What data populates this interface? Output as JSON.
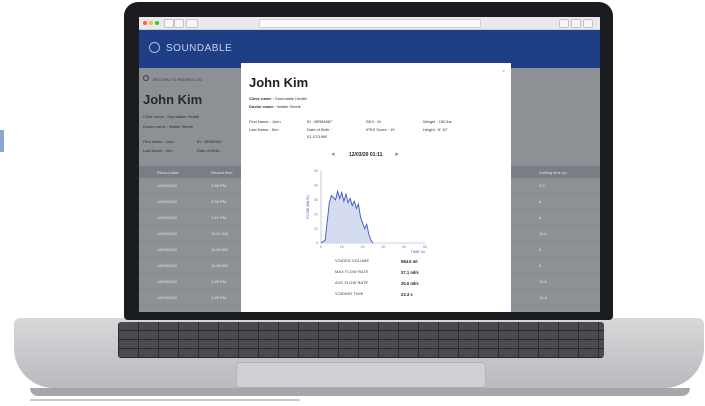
{
  "app": {
    "brand": "SOUNDABLE"
  },
  "background_page": {
    "back_link": "RETURN TO PATIENT LIST",
    "patient_name": "John Kim",
    "clinic_line": "Clinic name : Soundable Health",
    "doctor_line": "Doctor name : Walter Steele",
    "first_name_line": "First Name : John",
    "last_name_line": "Last Name : Kim",
    "id_line": "ID : BRM4567",
    "dob_line": "Date of Birth :",
    "table_headers": [
      "Record date",
      "Record time",
      "Voiding time (s)"
    ],
    "rows": [
      {
        "date": "12/03/2020",
        "time": "1:50  PM",
        "voiding": "9.9"
      },
      {
        "date": "12/03/2020",
        "time": "3:34  PM",
        "voiding": "8"
      },
      {
        "date": "12/03/2020",
        "time": "7:10  PM",
        "voiding": "8"
      },
      {
        "date": "12/03/2020",
        "time": "10:21  AM",
        "voiding": "11.4"
      },
      {
        "date": "13/03/2020",
        "time": "11:29  AM",
        "voiding": "5"
      },
      {
        "date": "13/03/2020",
        "time": "11:58  AM",
        "voiding": "5"
      },
      {
        "date": "13/03/2020",
        "time": "1:25  PM",
        "voiding": "13.5"
      },
      {
        "date": "14/03/2020",
        "time": "1:25  PM",
        "voiding": "14.4"
      }
    ]
  },
  "modal": {
    "close": "×",
    "patient_name": "John Kim",
    "clinic_label": "Clinic name :",
    "clinic_value": "Soundable Health",
    "doctor_label": "Doctor name :",
    "doctor_value": "Walter Steele",
    "first_name": "First Name : John",
    "last_name": "Last Name : Kim",
    "id": "ID : BRM4567",
    "dob_label": "Date of Birth :",
    "dob_value": "01-07/1960",
    "sex": "SEX : M",
    "ipss": "IPSS Score : 19",
    "weight": "Weight : 150 lbs",
    "height": "Height : 5' 10\"",
    "nav_prev": "<",
    "nav_next": ">",
    "record_datetime": "12/03/20 01:11",
    "stats": [
      {
        "label": "VOIDED VOLUME",
        "value": "584.5 ml"
      },
      {
        "label": "MAX FLOW RATE",
        "value": "37.1 ml/s"
      },
      {
        "label": "AVG FLOW RATE",
        "value": "25.0 ml/s"
      },
      {
        "label": "VOIDING TIME",
        "value": "23.3 s"
      }
    ]
  },
  "chart_data": {
    "type": "area",
    "ylabel": "FLOW (ML/S)",
    "xlabel": "TIME (s)",
    "xticks": [
      0,
      10,
      20,
      30,
      40,
      50
    ],
    "yticks": [
      0,
      10,
      20,
      30,
      40,
      50
    ],
    "xlim": [
      0,
      50
    ],
    "ylim": [
      0,
      50
    ],
    "x": [
      0,
      2,
      4,
      5,
      7,
      8,
      9,
      10,
      11,
      12,
      13,
      14,
      15,
      16,
      17,
      18,
      19,
      20,
      21,
      22,
      23,
      24,
      25
    ],
    "y": [
      0,
      2,
      28,
      33,
      30,
      36,
      31,
      35,
      29,
      34,
      28,
      31,
      26,
      29,
      24,
      27,
      18,
      14,
      10,
      13,
      6,
      2,
      0
    ],
    "color": "#3b57c9",
    "fill": "#d6dcef"
  }
}
